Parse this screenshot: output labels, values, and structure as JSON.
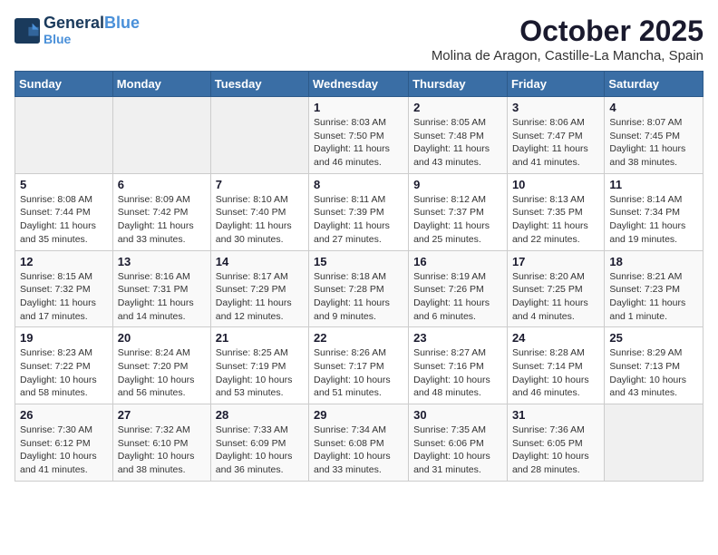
{
  "header": {
    "logo_line1": "General",
    "logo_line2": "Blue",
    "title": "October 2025",
    "subtitle": "Molina de Aragon, Castille-La Mancha, Spain"
  },
  "days_of_week": [
    "Sunday",
    "Monday",
    "Tuesday",
    "Wednesday",
    "Thursday",
    "Friday",
    "Saturday"
  ],
  "weeks": [
    [
      {
        "day": "",
        "info": ""
      },
      {
        "day": "",
        "info": ""
      },
      {
        "day": "",
        "info": ""
      },
      {
        "day": "1",
        "info": "Sunrise: 8:03 AM\nSunset: 7:50 PM\nDaylight: 11 hours and 46 minutes."
      },
      {
        "day": "2",
        "info": "Sunrise: 8:05 AM\nSunset: 7:48 PM\nDaylight: 11 hours and 43 minutes."
      },
      {
        "day": "3",
        "info": "Sunrise: 8:06 AM\nSunset: 7:47 PM\nDaylight: 11 hours and 41 minutes."
      },
      {
        "day": "4",
        "info": "Sunrise: 8:07 AM\nSunset: 7:45 PM\nDaylight: 11 hours and 38 minutes."
      }
    ],
    [
      {
        "day": "5",
        "info": "Sunrise: 8:08 AM\nSunset: 7:44 PM\nDaylight: 11 hours and 35 minutes."
      },
      {
        "day": "6",
        "info": "Sunrise: 8:09 AM\nSunset: 7:42 PM\nDaylight: 11 hours and 33 minutes."
      },
      {
        "day": "7",
        "info": "Sunrise: 8:10 AM\nSunset: 7:40 PM\nDaylight: 11 hours and 30 minutes."
      },
      {
        "day": "8",
        "info": "Sunrise: 8:11 AM\nSunset: 7:39 PM\nDaylight: 11 hours and 27 minutes."
      },
      {
        "day": "9",
        "info": "Sunrise: 8:12 AM\nSunset: 7:37 PM\nDaylight: 11 hours and 25 minutes."
      },
      {
        "day": "10",
        "info": "Sunrise: 8:13 AM\nSunset: 7:35 PM\nDaylight: 11 hours and 22 minutes."
      },
      {
        "day": "11",
        "info": "Sunrise: 8:14 AM\nSunset: 7:34 PM\nDaylight: 11 hours and 19 minutes."
      }
    ],
    [
      {
        "day": "12",
        "info": "Sunrise: 8:15 AM\nSunset: 7:32 PM\nDaylight: 11 hours and 17 minutes."
      },
      {
        "day": "13",
        "info": "Sunrise: 8:16 AM\nSunset: 7:31 PM\nDaylight: 11 hours and 14 minutes."
      },
      {
        "day": "14",
        "info": "Sunrise: 8:17 AM\nSunset: 7:29 PM\nDaylight: 11 hours and 12 minutes."
      },
      {
        "day": "15",
        "info": "Sunrise: 8:18 AM\nSunset: 7:28 PM\nDaylight: 11 hours and 9 minutes."
      },
      {
        "day": "16",
        "info": "Sunrise: 8:19 AM\nSunset: 7:26 PM\nDaylight: 11 hours and 6 minutes."
      },
      {
        "day": "17",
        "info": "Sunrise: 8:20 AM\nSunset: 7:25 PM\nDaylight: 11 hours and 4 minutes."
      },
      {
        "day": "18",
        "info": "Sunrise: 8:21 AM\nSunset: 7:23 PM\nDaylight: 11 hours and 1 minute."
      }
    ],
    [
      {
        "day": "19",
        "info": "Sunrise: 8:23 AM\nSunset: 7:22 PM\nDaylight: 10 hours and 58 minutes."
      },
      {
        "day": "20",
        "info": "Sunrise: 8:24 AM\nSunset: 7:20 PM\nDaylight: 10 hours and 56 minutes."
      },
      {
        "day": "21",
        "info": "Sunrise: 8:25 AM\nSunset: 7:19 PM\nDaylight: 10 hours and 53 minutes."
      },
      {
        "day": "22",
        "info": "Sunrise: 8:26 AM\nSunset: 7:17 PM\nDaylight: 10 hours and 51 minutes."
      },
      {
        "day": "23",
        "info": "Sunrise: 8:27 AM\nSunset: 7:16 PM\nDaylight: 10 hours and 48 minutes."
      },
      {
        "day": "24",
        "info": "Sunrise: 8:28 AM\nSunset: 7:14 PM\nDaylight: 10 hours and 46 minutes."
      },
      {
        "day": "25",
        "info": "Sunrise: 8:29 AM\nSunset: 7:13 PM\nDaylight: 10 hours and 43 minutes."
      }
    ],
    [
      {
        "day": "26",
        "info": "Sunrise: 7:30 AM\nSunset: 6:12 PM\nDaylight: 10 hours and 41 minutes."
      },
      {
        "day": "27",
        "info": "Sunrise: 7:32 AM\nSunset: 6:10 PM\nDaylight: 10 hours and 38 minutes."
      },
      {
        "day": "28",
        "info": "Sunrise: 7:33 AM\nSunset: 6:09 PM\nDaylight: 10 hours and 36 minutes."
      },
      {
        "day": "29",
        "info": "Sunrise: 7:34 AM\nSunset: 6:08 PM\nDaylight: 10 hours and 33 minutes."
      },
      {
        "day": "30",
        "info": "Sunrise: 7:35 AM\nSunset: 6:06 PM\nDaylight: 10 hours and 31 minutes."
      },
      {
        "day": "31",
        "info": "Sunrise: 7:36 AM\nSunset: 6:05 PM\nDaylight: 10 hours and 28 minutes."
      },
      {
        "day": "",
        "info": ""
      }
    ]
  ]
}
